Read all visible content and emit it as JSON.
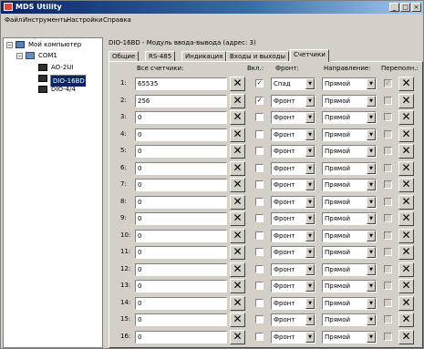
{
  "window": {
    "title": "MDS Utility",
    "buttons": {
      "minimize": "_",
      "maximize": "□",
      "close": "×"
    }
  },
  "menu": [
    "Файл",
    "Инструменты",
    "Настройки",
    "Справка"
  ],
  "tree": [
    {
      "label": "Мой компьютер",
      "level": 0,
      "expander": "−",
      "icon": "computer-icon",
      "selected": false
    },
    {
      "label": "COM1",
      "level": 1,
      "expander": "−",
      "icon": "port-icon",
      "selected": false
    },
    {
      "label": "AO-2UI",
      "level": 2,
      "expander": "",
      "icon": "module-icon",
      "selected": false
    },
    {
      "label": "DIO-16BD",
      "level": 2,
      "expander": "",
      "icon": "module-icon",
      "selected": true
    },
    {
      "label": "DIO-4/4",
      "level": 2,
      "expander": "",
      "icon": "module-icon",
      "selected": false
    }
  ],
  "device_header": "DIO-16BD - Модуль ввода-вывода (адрес: 3)",
  "tabs": [
    "Общие",
    "RS-485",
    "Индикация",
    "Входы и выходы",
    "Счетчики"
  ],
  "active_tab": 4,
  "columns": {
    "all_counters": "Все счетчики:",
    "enabled": "Вкл.:",
    "edge": "Фронт:",
    "direction": "Направление:",
    "overflow": "Переполн.:"
  },
  "rows": [
    {
      "num": "1:",
      "value": "65535",
      "enabled": true,
      "edge": "Спад",
      "direction": "Прямой",
      "overflow": true
    },
    {
      "num": "2:",
      "value": "256",
      "enabled": true,
      "edge": "Фронт",
      "direction": "Прямой",
      "overflow": false
    },
    {
      "num": "3:",
      "value": "0",
      "enabled": false,
      "edge": "Фронт",
      "direction": "Прямой",
      "overflow": false
    },
    {
      "num": "4:",
      "value": "0",
      "enabled": false,
      "edge": "Фронт",
      "direction": "Прямой",
      "overflow": false
    },
    {
      "num": "5:",
      "value": "0",
      "enabled": false,
      "edge": "Фронт",
      "direction": "Прямой",
      "overflow": false
    },
    {
      "num": "6:",
      "value": "0",
      "enabled": false,
      "edge": "Фронт",
      "direction": "Прямой",
      "overflow": false
    },
    {
      "num": "7:",
      "value": "0",
      "enabled": false,
      "edge": "Фронт",
      "direction": "Прямой",
      "overflow": false
    },
    {
      "num": "8:",
      "value": "0",
      "enabled": false,
      "edge": "Фронт",
      "direction": "Прямой",
      "overflow": false
    },
    {
      "num": "9:",
      "value": "0",
      "enabled": false,
      "edge": "Фронт",
      "direction": "Прямой",
      "overflow": false
    },
    {
      "num": "10:",
      "value": "0",
      "enabled": false,
      "edge": "Фронт",
      "direction": "Прямой",
      "overflow": false
    },
    {
      "num": "11:",
      "value": "0",
      "enabled": false,
      "edge": "Фронт",
      "direction": "Прямой",
      "overflow": false
    },
    {
      "num": "12:",
      "value": "0",
      "enabled": false,
      "edge": "Фронт",
      "direction": "Прямой",
      "overflow": false
    },
    {
      "num": "13:",
      "value": "0",
      "enabled": false,
      "edge": "Фронт",
      "direction": "Прямой",
      "overflow": false
    },
    {
      "num": "14:",
      "value": "0",
      "enabled": false,
      "edge": "Фронт",
      "direction": "Прямой",
      "overflow": false
    },
    {
      "num": "15:",
      "value": "0",
      "enabled": false,
      "edge": "Фронт",
      "direction": "Прямой",
      "overflow": false
    },
    {
      "num": "16:",
      "value": "0",
      "enabled": false,
      "edge": "Фронт",
      "direction": "Прямой",
      "overflow": false
    }
  ],
  "glyphs": {
    "clear": "✕",
    "check": "✓",
    "dropdown": "▼"
  },
  "colors": {
    "titlebar": "#0a246a",
    "selection": "#0a246a",
    "face": "#d4d0c8"
  }
}
